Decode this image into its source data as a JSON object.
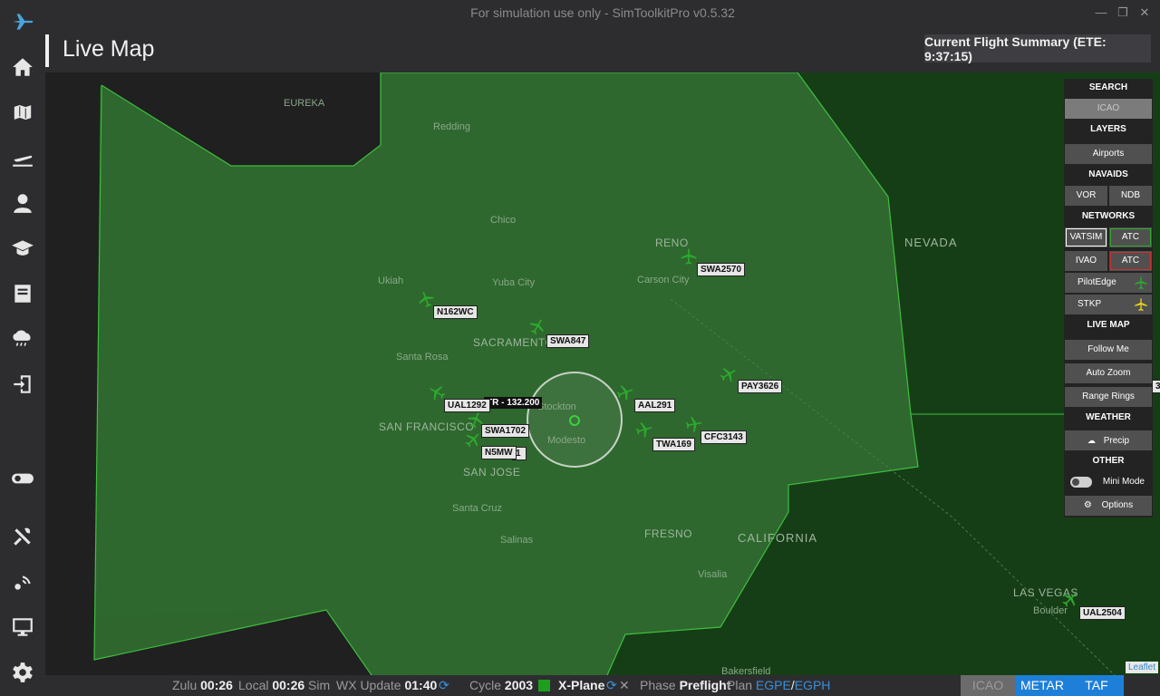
{
  "app": {
    "title": "For simulation use only - SimToolkitPro v0.5.32",
    "window_buttons": [
      "—",
      "❐",
      "✕"
    ]
  },
  "header": {
    "title": "Live Map",
    "summary": "Current Flight Summary (ETE: 9:37:15)"
  },
  "sidebar": {
    "items": [
      {
        "icon": "app-logo-icon"
      },
      {
        "icon": "home-icon"
      },
      {
        "icon": "map-icon"
      },
      {
        "icon": "flights-icon"
      },
      {
        "icon": "profile-icon"
      },
      {
        "icon": "training-icon"
      },
      {
        "icon": "logbook-icon"
      },
      {
        "icon": "weather-icon"
      },
      {
        "icon": "import-icon"
      },
      {
        "icon": "toggle-icon"
      },
      {
        "icon": "tools-icon"
      },
      {
        "icon": "connection-icon"
      },
      {
        "icon": "monitor-icon"
      },
      {
        "icon": "settings-icon"
      }
    ]
  },
  "map": {
    "states": {
      "nevada": "NEVADA",
      "california": "CALIFORNIA"
    },
    "cities": {
      "eureka": "EUREKA",
      "redding": "Redding",
      "chico": "Chico",
      "reno": "RENO",
      "ukiah": "Ukiah",
      "yuba_city": "Yuba City",
      "carson_city": "Carson City",
      "sacramento": "SACRAMENTO",
      "santa_rosa": "Santa Rosa",
      "san_francisco": "SAN FRANCISCO",
      "stockton": "Stockton",
      "modesto": "Modesto",
      "san_jose": "SAN JOSE",
      "santa_cruz": "Santa Cruz",
      "salinas": "Salinas",
      "fresno": "FRESNO",
      "visalia": "Visalia",
      "bakersfield": "Bakersfield",
      "las_vegas": "LAS VEGAS",
      "boulder": "Boulder"
    },
    "atc_label": "TR - 132.200",
    "callsigns": {
      "swa2570": "SWA2570",
      "n162wc": "N162WC",
      "swa847": "SWA847",
      "pay3626": "PAY3626",
      "ual1292": "UAL1292",
      "aal291": "AAL291",
      "swa1702": "SWA1702",
      "twa169": "TWA169",
      "cfc3143": "CFC3143",
      "n5mw": "N5MW",
      "n5mw_suffix": "1",
      "ual2504": "UAL2504"
    },
    "edge_label": "3",
    "leaflet": "Leaflet",
    "colors": {
      "flight_region": "#2f6a2f",
      "map_base": "#173f17",
      "pilotedge": "#2ea82e",
      "stkp": "#e6d21e"
    }
  },
  "panel": {
    "search": {
      "header": "SEARCH",
      "placeholder": "ICAO"
    },
    "layers": {
      "header": "LAYERS",
      "airports": "Airports"
    },
    "navaids": {
      "header": "NAVAIDS",
      "vor": "VOR",
      "ndb": "NDB"
    },
    "networks": {
      "header": "NETWORKS",
      "vatsim": "VATSIM",
      "vatsim_atc": "ATC",
      "ivao": "IVAO",
      "ivao_atc": "ATC",
      "pilotedge": "PilotEdge",
      "stkp": "STKP"
    },
    "live_map": {
      "header": "LIVE MAP",
      "follow_me": "Follow Me",
      "auto_zoom": "Auto Zoom",
      "range_rings": "Range Rings"
    },
    "weather": {
      "header": "WEATHER",
      "precip": "Precip"
    },
    "other": {
      "header": "OTHER",
      "mini_mode": "Mini Mode",
      "options": "Options"
    }
  },
  "status": {
    "zulu_label": "Zulu",
    "zulu": "00:26",
    "local_label": "Local",
    "local": "00:26",
    "sim_label": "Sim",
    "wx_label": "WX Update",
    "wx": "01:40",
    "cycle_label": "Cycle",
    "cycle": "2003",
    "sim_name": "X-Plane",
    "phase_label": "Phase",
    "phase": "Preflight",
    "plan_label": "Plan",
    "plan_from": "EGPE",
    "plan_sep": "/",
    "plan_to": "EGPH",
    "buttons": {
      "icao": "ICAO",
      "metar": "METAR",
      "taf": "TAF"
    }
  }
}
